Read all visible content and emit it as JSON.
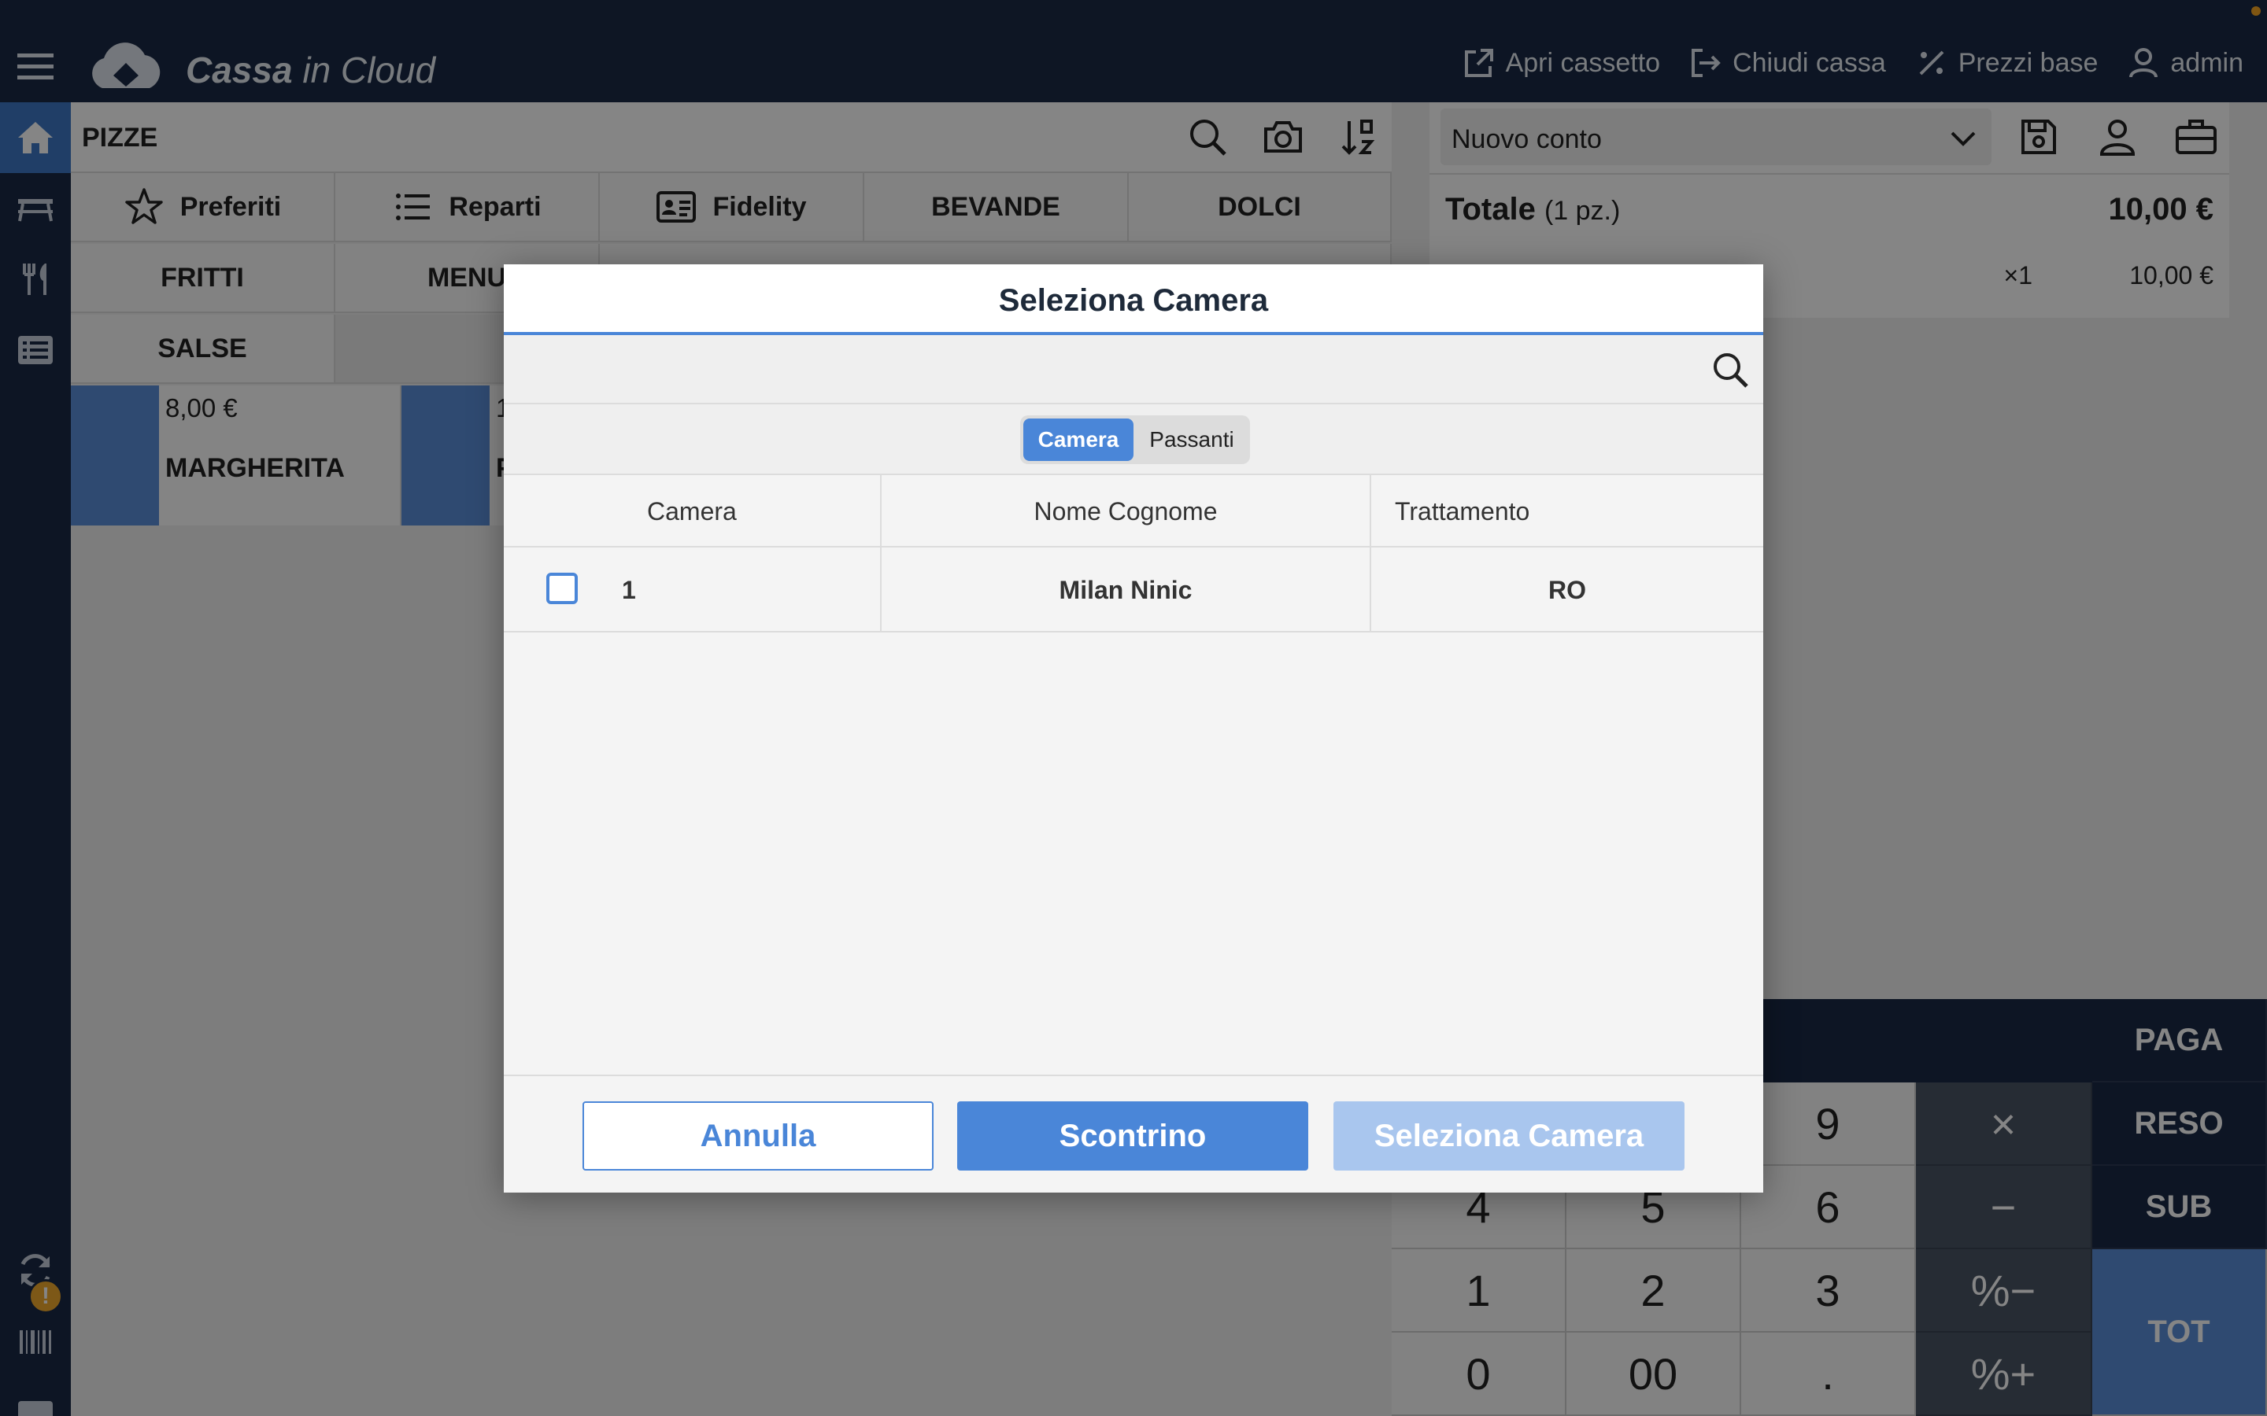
{
  "topbar": {
    "brand_bold": "Cassa",
    "brand_light": " in Cloud",
    "actions": [
      {
        "label": "Apri cassetto",
        "icon": "external-link-icon"
      },
      {
        "label": "Chiudi cassa",
        "icon": "logout-icon"
      },
      {
        "label": "Prezzi base",
        "icon": "percent-icon"
      },
      {
        "label": "admin",
        "icon": "user-icon"
      }
    ]
  },
  "sidenav": {
    "items": [
      "home-icon",
      "table-icon",
      "cutlery-icon",
      "list-icon",
      "sync-icon",
      "barcode-icon",
      "keyboard-icon"
    ],
    "badge": "!"
  },
  "products": {
    "category_title": "PIZZE",
    "categories": [
      {
        "label": "Preferiti",
        "icon": "star-icon"
      },
      {
        "label": "Reparti",
        "icon": "list-bullet-icon"
      },
      {
        "label": "Fidelity",
        "icon": "id-card-icon"
      },
      {
        "label": "BEVANDE"
      },
      {
        "label": "DOLCI"
      },
      {
        "label": "FRITTI"
      },
      {
        "label": "MENU"
      },
      {
        "label": "SALSE"
      }
    ],
    "tiles": [
      {
        "price": "8,00 €",
        "name": "MARGHERITA"
      },
      {
        "price": "1",
        "name": "P"
      }
    ]
  },
  "conto": {
    "selected": "Nuovo conto",
    "totale_label": "Totale",
    "totale_qty": "(1 pz.)",
    "totale_amount": "10,00 €",
    "line_qty": "×1",
    "line_amount": "10,00 €"
  },
  "keypad": {
    "keys": [
      "9",
      "4",
      "5",
      "6",
      "1",
      "2",
      "3",
      "0",
      "00",
      "."
    ],
    "ops": [
      "×",
      "−",
      "%−",
      "%+"
    ],
    "actions": [
      "PAGA",
      "RESO",
      "SUB",
      "TOT"
    ]
  },
  "modal": {
    "title": "Seleziona Camera",
    "search_placeholder": "",
    "segments": [
      "Camera",
      "Passanti"
    ],
    "active_segment": "Camera",
    "columns": [
      "Camera",
      "Nome Cognome",
      "Trattamento"
    ],
    "rows": [
      {
        "camera": "1",
        "nome": "Milan Ninic",
        "trattamento": "RO"
      }
    ],
    "buttons": {
      "cancel": "Annulla",
      "receipt": "Scontrino",
      "select": "Seleziona Camera"
    }
  }
}
